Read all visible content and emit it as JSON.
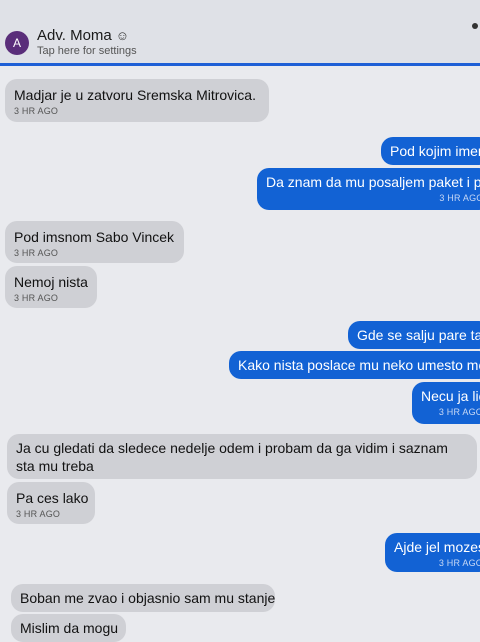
{
  "header": {
    "avatar_letter": "A",
    "title": "Adv. Moma",
    "title_icon": "☺",
    "subtitle": "Tap here for settings"
  },
  "colors": {
    "accent": "#1262d4",
    "incoming": "#cfd0d5",
    "avatar": "#5a2e7a"
  },
  "messages": [
    {
      "dir": "in",
      "text": "Madjar je u zatvoru Sremska Mitrovica.",
      "time": "3 HR AGO"
    },
    {
      "dir": "out",
      "text": "Pod kojim imen",
      "time": ""
    },
    {
      "dir": "out",
      "text": "Da znam da mu posaljem paket i p",
      "time": "3 HR AGC"
    },
    {
      "dir": "in",
      "text": "Pod imsnom Sabo Vincek",
      "time": "3 HR AGO"
    },
    {
      "dir": "in",
      "text": "Nemoj nista",
      "time": "3 HR AGO"
    },
    {
      "dir": "out",
      "text": "Gde se salju pare ta",
      "time": ""
    },
    {
      "dir": "out",
      "text": "Kako nista poslace mu neko umesto me",
      "time": ""
    },
    {
      "dir": "out",
      "text": "Necu ja lic",
      "time": "3 HR AGO"
    },
    {
      "dir": "in",
      "text": "Ja cu gledati da sledece nedelje odem i probam da ga vidim i saznam sta mu treba",
      "time": ""
    },
    {
      "dir": "in",
      "text": "Pa ces lako",
      "time": "3 HR AGO"
    },
    {
      "dir": "out",
      "text": "Ajde jel mozes",
      "time": "3 HR AGO"
    },
    {
      "dir": "in",
      "text": "Boban me zvao i objasnio sam mu stanje",
      "time": ""
    },
    {
      "dir": "in",
      "text": "Mislim da mogu",
      "time": ""
    }
  ]
}
